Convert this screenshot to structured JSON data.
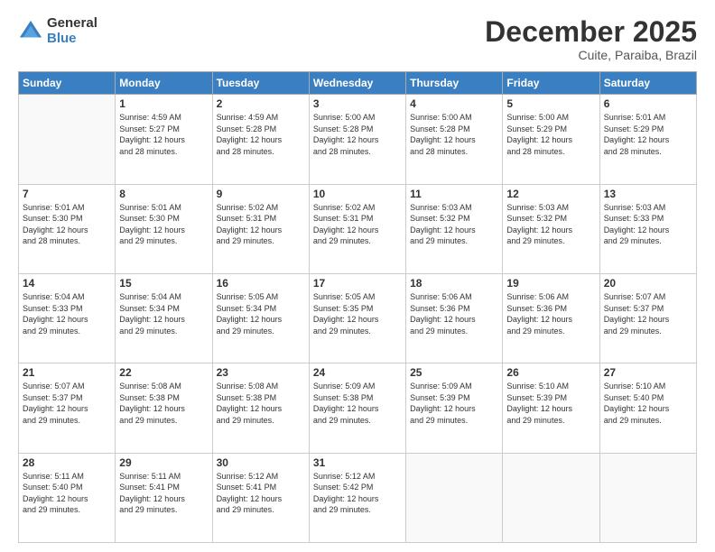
{
  "logo": {
    "general": "General",
    "blue": "Blue"
  },
  "header": {
    "month": "December 2025",
    "location": "Cuite, Paraiba, Brazil"
  },
  "weekdays": [
    "Sunday",
    "Monday",
    "Tuesday",
    "Wednesday",
    "Thursday",
    "Friday",
    "Saturday"
  ],
  "weeks": [
    [
      {
        "day": "",
        "info": ""
      },
      {
        "day": "1",
        "info": "Sunrise: 4:59 AM\nSunset: 5:27 PM\nDaylight: 12 hours\nand 28 minutes."
      },
      {
        "day": "2",
        "info": "Sunrise: 4:59 AM\nSunset: 5:28 PM\nDaylight: 12 hours\nand 28 minutes."
      },
      {
        "day": "3",
        "info": "Sunrise: 5:00 AM\nSunset: 5:28 PM\nDaylight: 12 hours\nand 28 minutes."
      },
      {
        "day": "4",
        "info": "Sunrise: 5:00 AM\nSunset: 5:28 PM\nDaylight: 12 hours\nand 28 minutes."
      },
      {
        "day": "5",
        "info": "Sunrise: 5:00 AM\nSunset: 5:29 PM\nDaylight: 12 hours\nand 28 minutes."
      },
      {
        "day": "6",
        "info": "Sunrise: 5:01 AM\nSunset: 5:29 PM\nDaylight: 12 hours\nand 28 minutes."
      }
    ],
    [
      {
        "day": "7",
        "info": "Sunrise: 5:01 AM\nSunset: 5:30 PM\nDaylight: 12 hours\nand 28 minutes."
      },
      {
        "day": "8",
        "info": "Sunrise: 5:01 AM\nSunset: 5:30 PM\nDaylight: 12 hours\nand 29 minutes."
      },
      {
        "day": "9",
        "info": "Sunrise: 5:02 AM\nSunset: 5:31 PM\nDaylight: 12 hours\nand 29 minutes."
      },
      {
        "day": "10",
        "info": "Sunrise: 5:02 AM\nSunset: 5:31 PM\nDaylight: 12 hours\nand 29 minutes."
      },
      {
        "day": "11",
        "info": "Sunrise: 5:03 AM\nSunset: 5:32 PM\nDaylight: 12 hours\nand 29 minutes."
      },
      {
        "day": "12",
        "info": "Sunrise: 5:03 AM\nSunset: 5:32 PM\nDaylight: 12 hours\nand 29 minutes."
      },
      {
        "day": "13",
        "info": "Sunrise: 5:03 AM\nSunset: 5:33 PM\nDaylight: 12 hours\nand 29 minutes."
      }
    ],
    [
      {
        "day": "14",
        "info": "Sunrise: 5:04 AM\nSunset: 5:33 PM\nDaylight: 12 hours\nand 29 minutes."
      },
      {
        "day": "15",
        "info": "Sunrise: 5:04 AM\nSunset: 5:34 PM\nDaylight: 12 hours\nand 29 minutes."
      },
      {
        "day": "16",
        "info": "Sunrise: 5:05 AM\nSunset: 5:34 PM\nDaylight: 12 hours\nand 29 minutes."
      },
      {
        "day": "17",
        "info": "Sunrise: 5:05 AM\nSunset: 5:35 PM\nDaylight: 12 hours\nand 29 minutes."
      },
      {
        "day": "18",
        "info": "Sunrise: 5:06 AM\nSunset: 5:36 PM\nDaylight: 12 hours\nand 29 minutes."
      },
      {
        "day": "19",
        "info": "Sunrise: 5:06 AM\nSunset: 5:36 PM\nDaylight: 12 hours\nand 29 minutes."
      },
      {
        "day": "20",
        "info": "Sunrise: 5:07 AM\nSunset: 5:37 PM\nDaylight: 12 hours\nand 29 minutes."
      }
    ],
    [
      {
        "day": "21",
        "info": "Sunrise: 5:07 AM\nSunset: 5:37 PM\nDaylight: 12 hours\nand 29 minutes."
      },
      {
        "day": "22",
        "info": "Sunrise: 5:08 AM\nSunset: 5:38 PM\nDaylight: 12 hours\nand 29 minutes."
      },
      {
        "day": "23",
        "info": "Sunrise: 5:08 AM\nSunset: 5:38 PM\nDaylight: 12 hours\nand 29 minutes."
      },
      {
        "day": "24",
        "info": "Sunrise: 5:09 AM\nSunset: 5:38 PM\nDaylight: 12 hours\nand 29 minutes."
      },
      {
        "day": "25",
        "info": "Sunrise: 5:09 AM\nSunset: 5:39 PM\nDaylight: 12 hours\nand 29 minutes."
      },
      {
        "day": "26",
        "info": "Sunrise: 5:10 AM\nSunset: 5:39 PM\nDaylight: 12 hours\nand 29 minutes."
      },
      {
        "day": "27",
        "info": "Sunrise: 5:10 AM\nSunset: 5:40 PM\nDaylight: 12 hours\nand 29 minutes."
      }
    ],
    [
      {
        "day": "28",
        "info": "Sunrise: 5:11 AM\nSunset: 5:40 PM\nDaylight: 12 hours\nand 29 minutes."
      },
      {
        "day": "29",
        "info": "Sunrise: 5:11 AM\nSunset: 5:41 PM\nDaylight: 12 hours\nand 29 minutes."
      },
      {
        "day": "30",
        "info": "Sunrise: 5:12 AM\nSunset: 5:41 PM\nDaylight: 12 hours\nand 29 minutes."
      },
      {
        "day": "31",
        "info": "Sunrise: 5:12 AM\nSunset: 5:42 PM\nDaylight: 12 hours\nand 29 minutes."
      },
      {
        "day": "",
        "info": ""
      },
      {
        "day": "",
        "info": ""
      },
      {
        "day": "",
        "info": ""
      }
    ]
  ]
}
